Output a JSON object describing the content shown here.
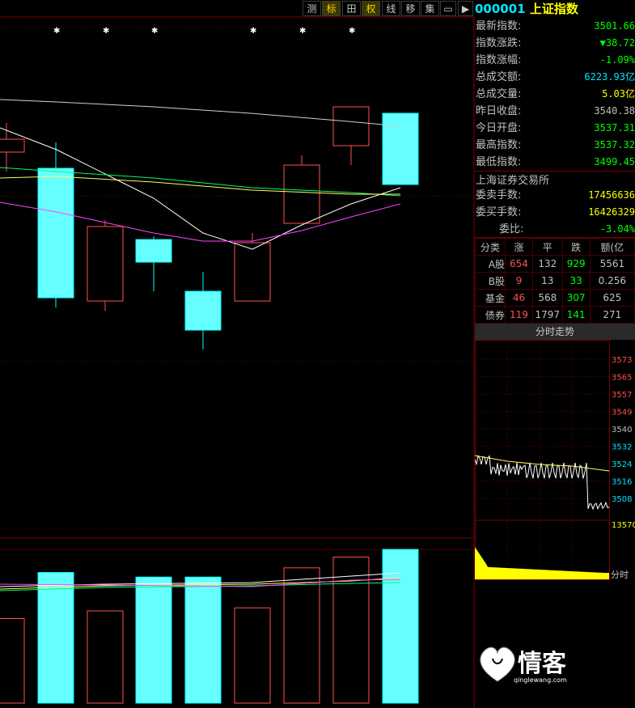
{
  "toolbar": {
    "buttons": [
      {
        "label": "测",
        "icon": "measure"
      },
      {
        "label": "标",
        "icon": "mark",
        "active": true
      },
      {
        "label": "田",
        "icon": "grid"
      },
      {
        "label": "权",
        "icon": "rights",
        "active": true
      },
      {
        "label": "线",
        "icon": "line"
      },
      {
        "label": "移",
        "icon": "move"
      },
      {
        "label": "集",
        "icon": "collect"
      },
      {
        "label": "▭",
        "icon": "window-icon"
      },
      {
        "label": "▶",
        "icon": "play-icon"
      }
    ]
  },
  "quote": {
    "code": "000001",
    "name": "上证指数",
    "rows": [
      {
        "label": "最新指数:",
        "value": "3501.66",
        "color": "#00ff00"
      },
      {
        "label": "指数涨跌:",
        "value": "▼38.72",
        "color": "#00ff00"
      },
      {
        "label": "指数涨幅:",
        "value": "-1.09%",
        "color": "#00ff00"
      },
      {
        "label": "总成交额:",
        "value": "6223.93亿",
        "color": "#00e5ff"
      },
      {
        "label": "总成交量:",
        "value": "5.03亿",
        "color": "#ffff00"
      },
      {
        "label": "昨日收盘:",
        "value": "3540.38",
        "color": "#c0c0c0"
      },
      {
        "label": "今日开盘:",
        "value": "3537.31",
        "color": "#00ff00"
      },
      {
        "label": "最高指数:",
        "value": "3537.32",
        "color": "#00ff00"
      },
      {
        "label": "最低指数:",
        "value": "3499.45",
        "color": "#00ff00"
      }
    ],
    "exchange": "上海证券交易所",
    "rows2": [
      {
        "label": "委卖手数:",
        "value": "17456636",
        "color": "#ffff00"
      },
      {
        "label": "委买手数:",
        "value": "16426329",
        "color": "#ffff00"
      },
      {
        "label": "委比:",
        "value": "-3.04%",
        "color": "#00ff00"
      }
    ]
  },
  "stats": {
    "headers": [
      "分类",
      "涨",
      "平",
      "跌",
      "额(亿"
    ],
    "rows": [
      {
        "cat": "A股",
        "up": "654",
        "flat": "132",
        "down": "929",
        "amt": "5561"
      },
      {
        "cat": "B股",
        "up": "9",
        "flat": "13",
        "down": "33",
        "amt": "0.256"
      },
      {
        "cat": "基金",
        "up": "46",
        "flat": "568",
        "down": "307",
        "amt": "625"
      },
      {
        "cat": "债券",
        "up": "119",
        "flat": "1797",
        "down": "141",
        "amt": "271"
      }
    ]
  },
  "minute": {
    "title": "分时走势",
    "y_ticks": [
      "3573",
      "3565",
      "3557",
      "3549",
      "3540",
      "3532",
      "3524",
      "3516",
      "3508"
    ],
    "vol_label": "13570",
    "footer": "分时"
  },
  "logo": {
    "text": "情客",
    "sub": "qinglewang.com"
  },
  "chart_data": {
    "type": "candlestick",
    "candles": [
      {
        "o": 3587,
        "h": 3592,
        "l": 3577,
        "c": 3583,
        "dir": "up"
      },
      {
        "o": 3578,
        "h": 3586,
        "l": 3535,
        "c": 3538,
        "dir": "down"
      },
      {
        "o": 3560,
        "h": 3562,
        "l": 3534,
        "c": 3537,
        "dir": "up"
      },
      {
        "o": 3556,
        "h": 3557,
        "l": 3540,
        "c": 3549,
        "dir": "down"
      },
      {
        "o": 3540,
        "h": 3546,
        "l": 3522,
        "c": 3528,
        "dir": "down"
      },
      {
        "o": 3537,
        "h": 3558,
        "l": 3537,
        "c": 3555,
        "dir": "up"
      },
      {
        "o": 3561,
        "h": 3582,
        "l": 3561,
        "c": 3579,
        "dir": "up"
      },
      {
        "o": 3585,
        "h": 3592,
        "l": 3579,
        "c": 3597,
        "dir": "up"
      },
      {
        "o": 3595,
        "h": 3594,
        "l": 3573,
        "c": 3573,
        "dir": "down"
      }
    ],
    "volumes": [
      0.55,
      0.85,
      0.6,
      0.82,
      0.82,
      0.62,
      0.88,
      0.95,
      1.0
    ],
    "marks_x": [
      1,
      2,
      3,
      5,
      6,
      7
    ]
  }
}
